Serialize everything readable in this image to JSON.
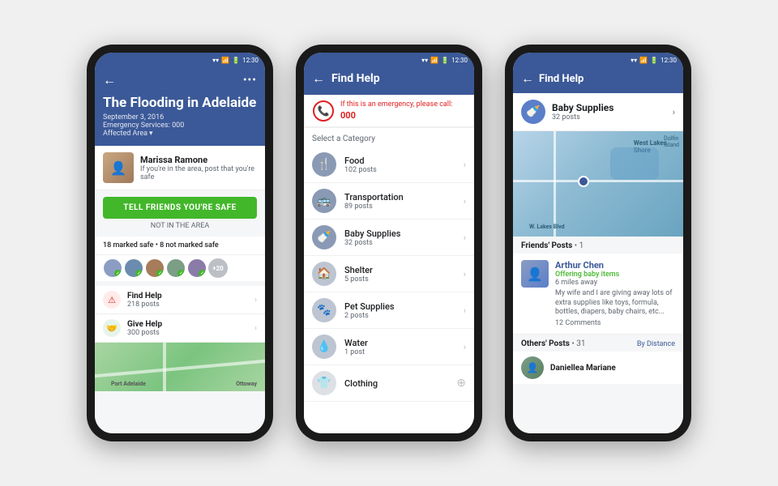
{
  "phones": {
    "phone1": {
      "statusBar": {
        "time": "12:30"
      },
      "header": {
        "title": "The Flooding in Adelaide",
        "date": "September 3, 2016",
        "services": "Emergency Services: 000",
        "area": "Affected Area"
      },
      "profile": {
        "name": "Marissa Ramone",
        "subtitle": "If you're in the area, post that you're safe"
      },
      "safeButton": "TELL FRIENDS YOU'RE SAFE",
      "notInArea": "NOT IN THE AREA",
      "markedSafe": "18 marked safe • 8 not marked safe",
      "moreBadge": "+20",
      "helpItems": [
        {
          "icon": "🆘",
          "title": "Find Help",
          "posts": "218 posts",
          "iconClass": "help-icon-red"
        },
        {
          "icon": "🤝",
          "title": "Give Help",
          "posts": "300 posts",
          "iconClass": "help-icon-green"
        }
      ]
    },
    "phone2": {
      "statusBar": {
        "time": "12:30"
      },
      "header": {
        "title": "Find Help"
      },
      "emergency": {
        "line1": "If this is an emergency, please call:",
        "number": "000"
      },
      "categoryLabel": "Select a Category",
      "categories": [
        {
          "icon": "🍴",
          "name": "Food",
          "posts": "102 posts"
        },
        {
          "icon": "🚌",
          "name": "Transportation",
          "posts": "89 posts"
        },
        {
          "icon": "🍼",
          "name": "Baby Supplies",
          "posts": "32 posts"
        },
        {
          "icon": "🏠",
          "name": "Shelter",
          "posts": "5 posts"
        },
        {
          "icon": "🐾",
          "name": "Pet Supplies",
          "posts": "2 posts"
        },
        {
          "icon": "💧",
          "name": "Water",
          "posts": "1 post"
        },
        {
          "icon": "👕",
          "name": "Clothing",
          "posts": ""
        }
      ]
    },
    "phone3": {
      "statusBar": {
        "time": "12:30"
      },
      "header": {
        "title": "Find Help"
      },
      "category": {
        "name": "Baby Supplies",
        "posts": "32 posts"
      },
      "friendsPosts": {
        "label": "Friends' Posts",
        "count": "1",
        "post": {
          "name": "Arthur Chen",
          "subtitle": "Offering baby items",
          "distance": "6 miles away",
          "text": "My wife and I are giving away lots of extra supplies like toys, formula, bottles, diapers, baby chairs, etc...",
          "comments": "12 Comments"
        }
      },
      "othersPosts": {
        "label": "Others' Posts",
        "count": "31",
        "sortLabel": "By Distance",
        "post": {
          "name": "Daniellea Mariane"
        }
      }
    }
  }
}
